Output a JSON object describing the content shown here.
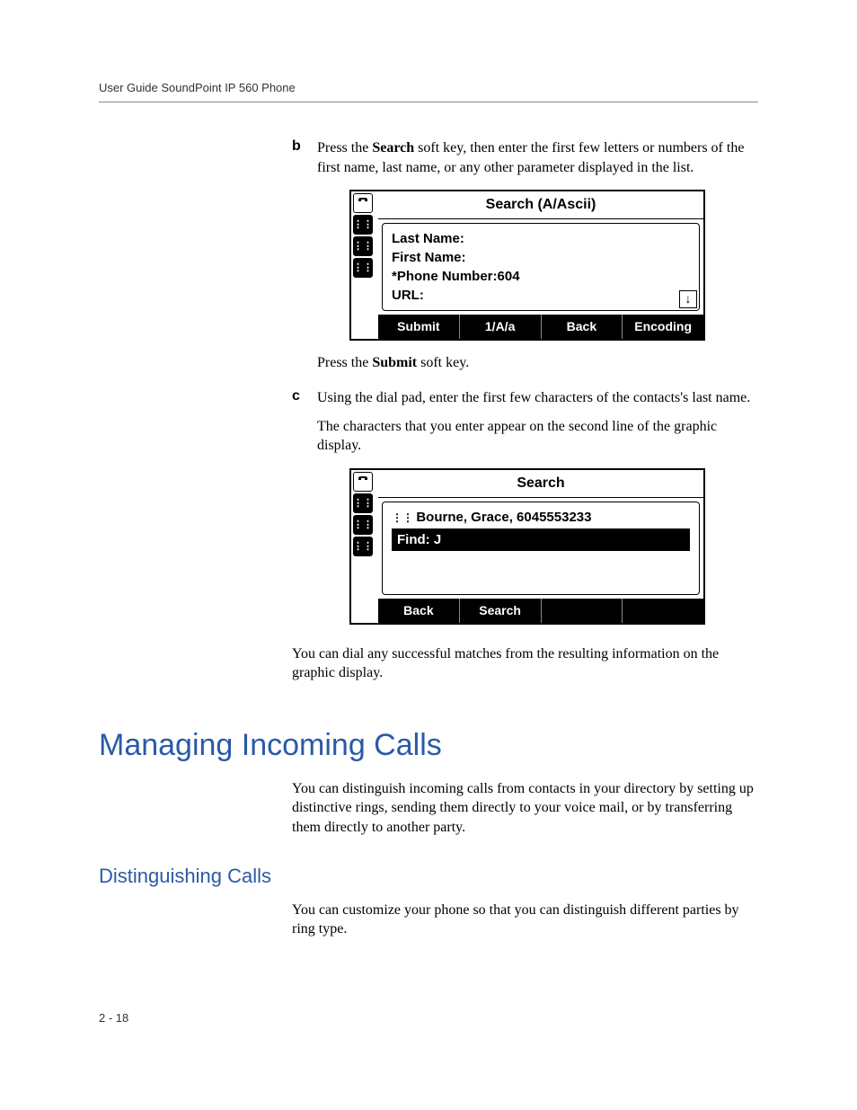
{
  "header": "User Guide SoundPoint IP 560 Phone",
  "step_b": {
    "label": "b",
    "text_parts": [
      "Press the ",
      "Search",
      " soft key, then enter the first few letters or numbers of the first name, last name, or any other parameter displayed in the list."
    ],
    "after_text_parts": [
      "Press the ",
      "Submit",
      " soft key."
    ]
  },
  "screen1": {
    "title": "Search (A/Ascii)",
    "lines": {
      "l1": "Last Name:",
      "l2": "First Name:",
      "l3": "*Phone Number:604",
      "l4": "URL:"
    },
    "softkeys": {
      "k1": "Submit",
      "k2": "1/A/a",
      "k3": "Back",
      "k4": "Encoding"
    }
  },
  "step_c": {
    "label": "c",
    "text1": "Using the dial pad, enter the first few characters of the contacts's last name.",
    "text2": "The characters that you enter appear on the second line of the graphic display."
  },
  "screen2": {
    "title": "Search",
    "entry": "Bourne, Grace, 6045553233",
    "find": "Find: J",
    "softkeys": {
      "k1": "Back",
      "k2": "Search"
    }
  },
  "after_screen2": "You can dial any successful matches from the resulting information on the graphic display.",
  "heading1": "Managing Incoming Calls",
  "para1": "You can distinguish incoming calls from contacts in your directory by setting up distinctive rings, sending them directly to your voice mail, or by transferring them directly to another party.",
  "heading2": "Distinguishing Calls",
  "para2": "You can customize your phone so that you can distinguish different parties by ring type.",
  "footer": "2 - 18",
  "icons": {
    "scroll_down": "↓",
    "grid": "⠿",
    "handset": "▭"
  }
}
